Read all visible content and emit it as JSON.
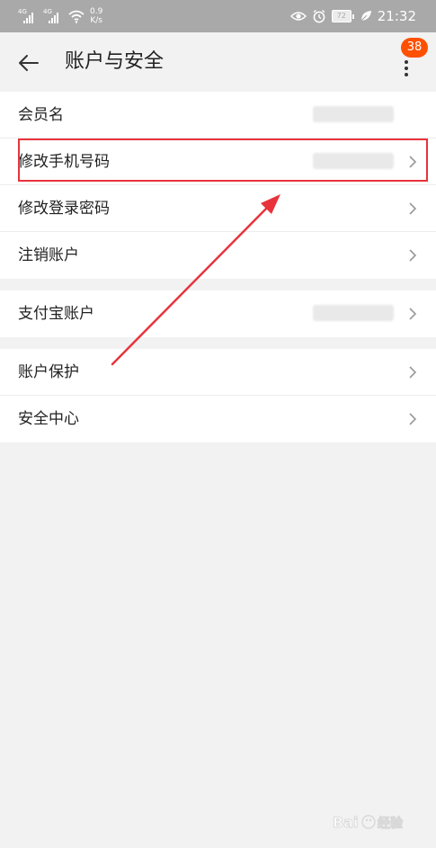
{
  "status_bar": {
    "signal_label": "4G",
    "net_speed_value": "0.9",
    "net_speed_unit": "K/s",
    "battery": "72",
    "time": "21:32"
  },
  "header": {
    "title": "账户与安全",
    "notification_count": "38"
  },
  "groups": [
    {
      "items": [
        {
          "label": "会员名",
          "has_chevron": false,
          "value_masked": true
        },
        {
          "label": "修改手机号码",
          "has_chevron": true,
          "value_masked": true,
          "highlighted": true
        },
        {
          "label": "修改登录密码",
          "has_chevron": true,
          "value_masked": false
        },
        {
          "label": "注销账户",
          "has_chevron": true,
          "value_masked": false
        }
      ]
    },
    {
      "items": [
        {
          "label": "支付宝账户",
          "has_chevron": true,
          "value_masked": true
        }
      ]
    },
    {
      "items": [
        {
          "label": "账户保护",
          "has_chevron": true,
          "value_masked": false
        },
        {
          "label": "安全中心",
          "has_chevron": true,
          "value_masked": false
        }
      ]
    }
  ],
  "colors": {
    "annotation": "#e8333c",
    "badge": "#ff5000",
    "background": "#f2f2f2",
    "status_bar": "#a9a9a9"
  },
  "icons": {
    "back": "arrow-left-icon",
    "more": "more-vertical-icon",
    "chevron": "chevron-right-icon",
    "wifi": "wifi-icon",
    "eye": "eye-icon",
    "alarm": "alarm-icon",
    "leaf": "leaf-icon"
  }
}
